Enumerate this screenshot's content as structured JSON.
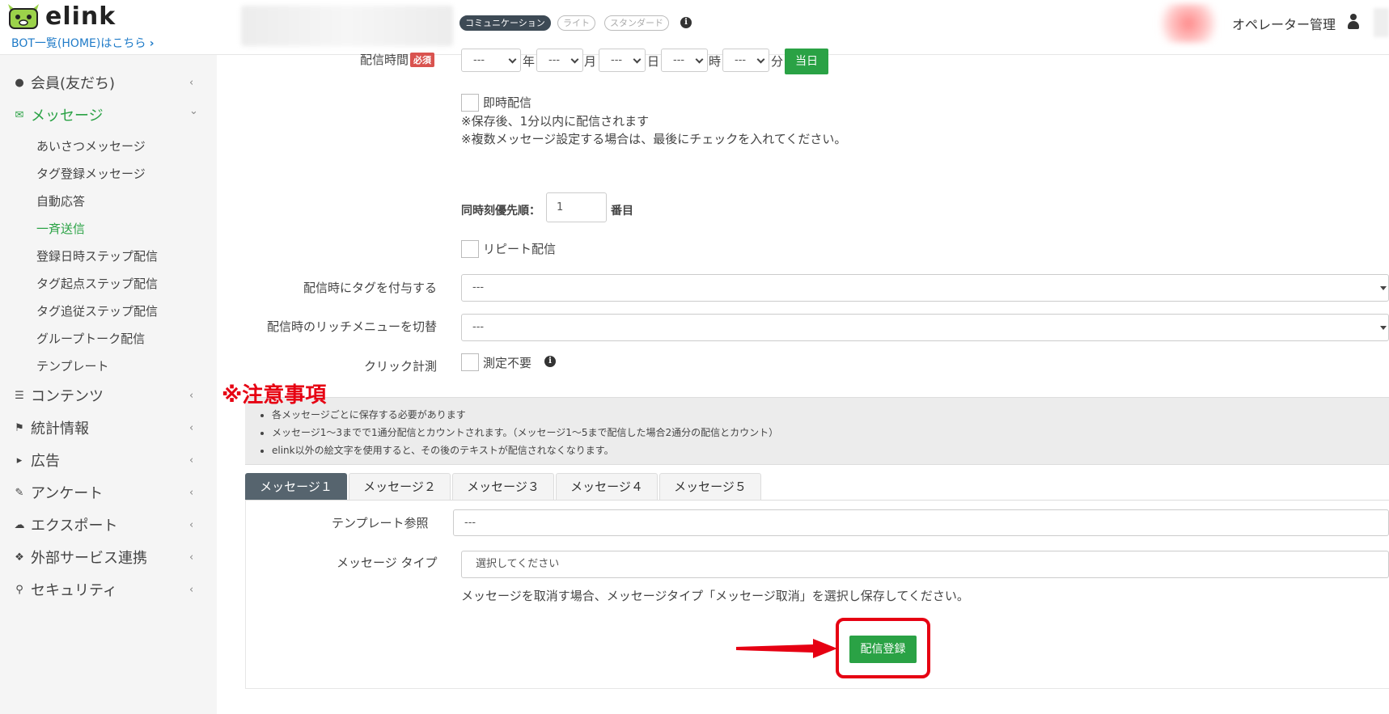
{
  "header": {
    "logo_text": "elink",
    "bot_link": "BOT一覧(HOME)はこちら",
    "plans": [
      "コミュニケーション",
      "ライト",
      "スタンダード"
    ],
    "operator_label": "オペレーター管理"
  },
  "sidebar": {
    "items": [
      {
        "label": "会員(友だち)",
        "icon": "user-icon",
        "chevron": "‹"
      },
      {
        "label": "メッセージ",
        "icon": "envelope-icon",
        "chevron": "⌄"
      },
      {
        "label": "コンテンツ",
        "icon": "list-icon",
        "chevron": "‹"
      },
      {
        "label": "統計情報",
        "icon": "flag-icon",
        "chevron": "‹"
      },
      {
        "label": "広告",
        "icon": "megaphone-icon",
        "chevron": "‹"
      },
      {
        "label": "アンケート",
        "icon": "pencil-icon",
        "chevron": "‹"
      },
      {
        "label": "エクスポート",
        "icon": "cloud-download-icon",
        "chevron": "‹"
      },
      {
        "label": "外部サービス連携",
        "icon": "cubes-icon",
        "chevron": "‹"
      },
      {
        "label": "セキュリティ",
        "icon": "key-icon",
        "chevron": "‹"
      }
    ],
    "message_sub": [
      "あいさつメッセージ",
      "タグ登録メッセージ",
      "自動応答",
      "一斉送信",
      "登録日時ステップ配信",
      "タグ起点ステップ配信",
      "タグ追従ステップ配信",
      "グループトーク配信",
      "テンプレート"
    ],
    "active_sub": "一斉送信"
  },
  "form": {
    "delivery_time_label": "配信時間",
    "required_badge": "必須",
    "date_selects": {
      "year": "---",
      "month": "---",
      "day": "---",
      "hour": "---",
      "minute": "---"
    },
    "units": {
      "year": "年",
      "month": "月",
      "day": "日",
      "hour": "時",
      "minute": "分"
    },
    "today_button": "当日",
    "immediate_label": "即時配信",
    "note1": "※保存後、1分以内に配信されます",
    "note2": "※複数メッセージ設定する場合は、最後にチェックを入れてください。",
    "priority_label": "同時刻優先順：",
    "priority_value": "1",
    "priority_suffix": "番目",
    "repeat_label": "リピート配信",
    "tag_label": "配信時にタグを付与する",
    "tag_value": "---",
    "richmenu_label": "配信時のリッチメニューを切替",
    "richmenu_value": "---",
    "click_label": "クリック計測",
    "click_option": "測定不要"
  },
  "notice": {
    "title": "※注意事項",
    "items": [
      "各メッセージごとに保存する必要があります",
      "メッセージ1～3までで1通分配信とカウントされます。（メッセージ1～5まで配信した場合2通分の配信とカウント）",
      "elink以外の絵文字を使用すると、その後のテキストが配信されなくなります。"
    ]
  },
  "tabs": [
    "メッセージ１",
    "メッセージ２",
    "メッセージ３",
    "メッセージ４",
    "メッセージ５"
  ],
  "message": {
    "template_label": "テンプレート参照",
    "template_value": "---",
    "type_label": "メッセージ タイプ",
    "type_value": "選択してください",
    "cancel_note": "メッセージを取消す場合、メッセージタイプ「メッセージ取消」を選択し保存してください。",
    "submit_button": "配信登録"
  },
  "colors": {
    "accent_green": "#2aa245",
    "highlight_red": "#e60012",
    "tab_active": "#56646e"
  }
}
